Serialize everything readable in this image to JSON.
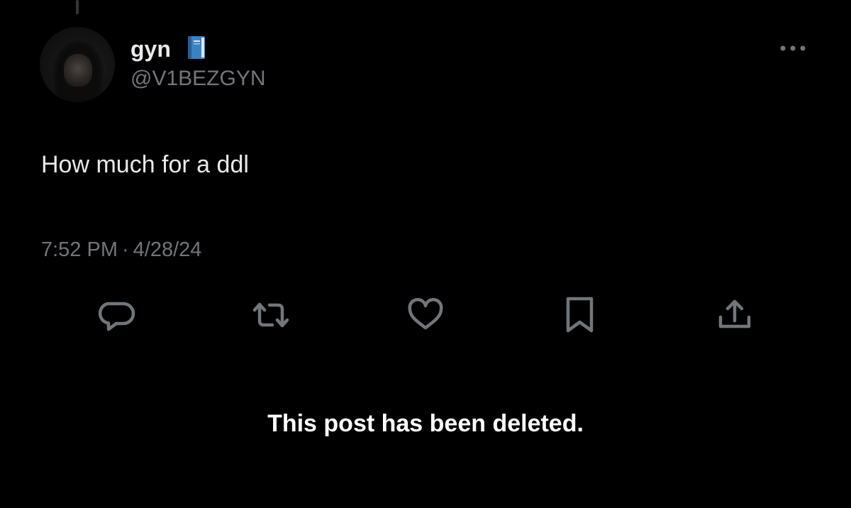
{
  "author": {
    "display_name": "gyn",
    "handle": "@V1BEZGYN",
    "name_emoji": "blue-book-icon"
  },
  "post": {
    "text": "How much for a ddl",
    "time": "7:52 PM",
    "separator": "·",
    "date": "4/28/24"
  },
  "actions": [
    {
      "name": "reply",
      "icon": "speech-bubble-icon"
    },
    {
      "name": "repost",
      "icon": "repost-arrows-icon"
    },
    {
      "name": "like",
      "icon": "heart-icon"
    },
    {
      "name": "bookmark",
      "icon": "bookmark-icon"
    },
    {
      "name": "share",
      "icon": "share-upload-icon"
    }
  ],
  "notice": {
    "text": "This post has been deleted."
  },
  "colors": {
    "background": "#000000",
    "primary_text": "#e7e9ea",
    "secondary_text": "#71767b",
    "book_blue": "#3b82c4"
  }
}
